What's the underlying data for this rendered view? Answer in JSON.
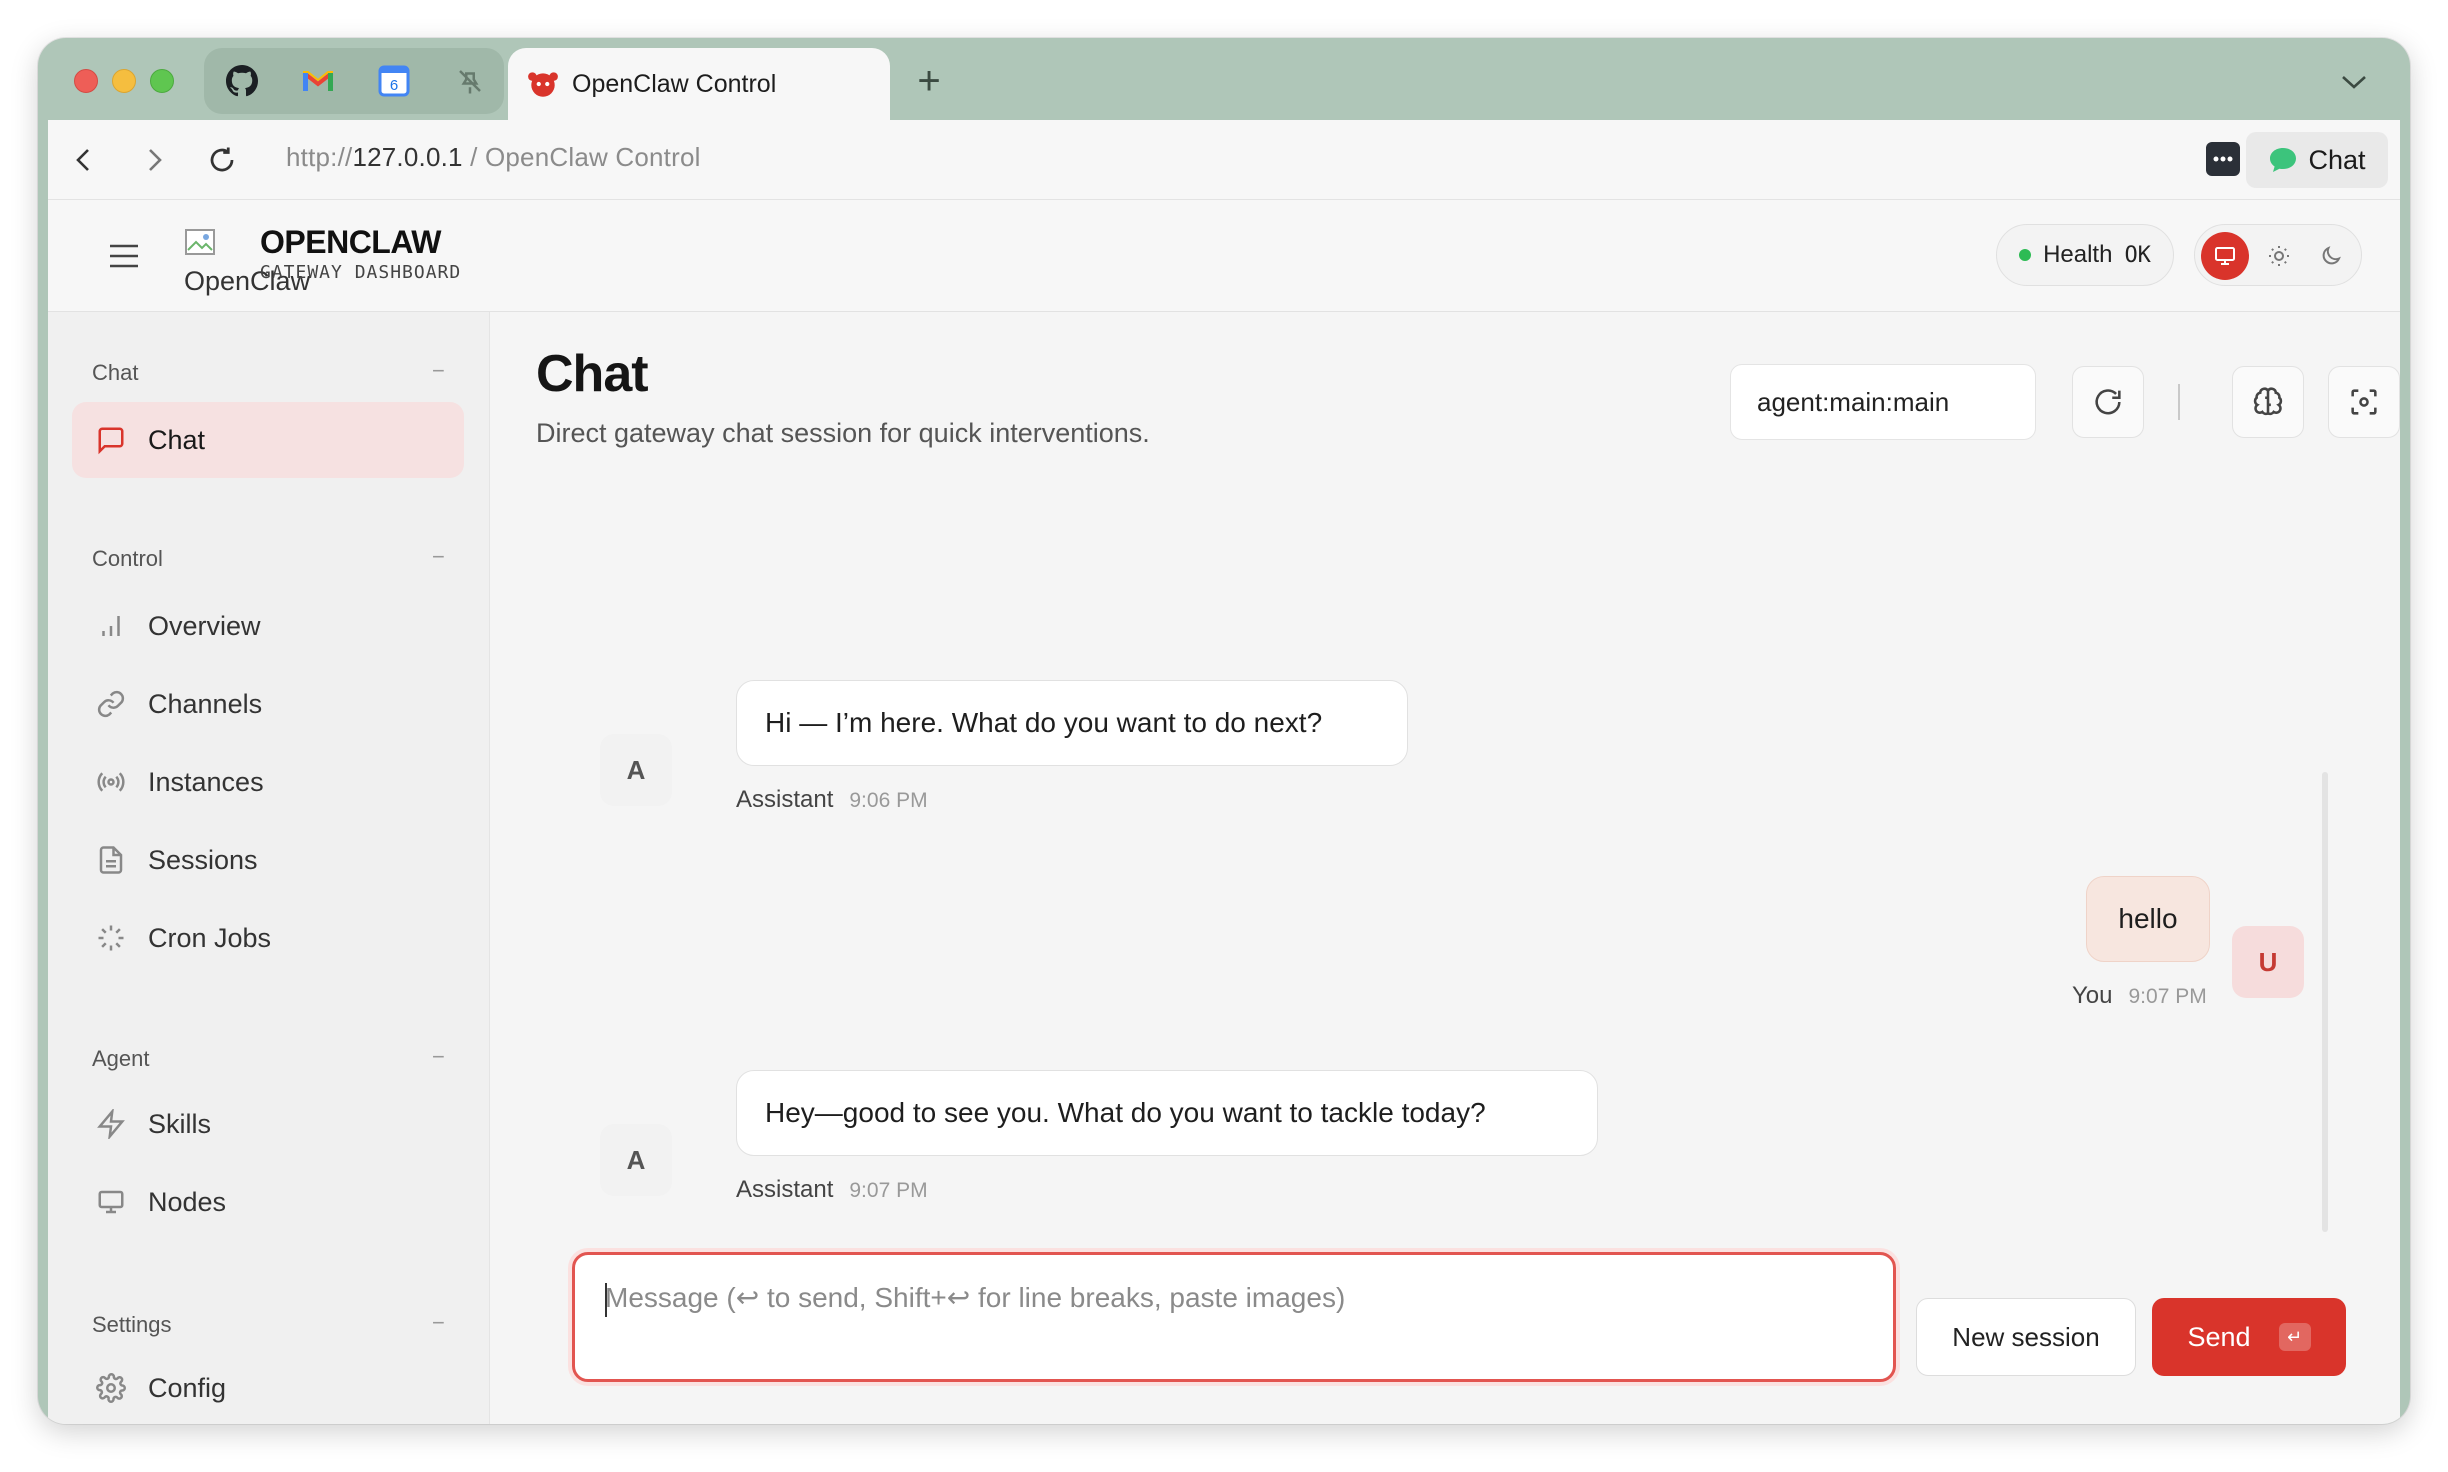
{
  "browser": {
    "active_tab_title": "OpenClaw Control",
    "new_tab_label": "+",
    "pinned_tabs": [
      "github-icon",
      "gmail-icon",
      "calendar-icon",
      "pin-icon"
    ],
    "calendar_badge": "6",
    "url_scheme": "http://",
    "url_host": "127.0.0.1",
    "url_rest": " / OpenClaw Control",
    "chat_extension_label": "Chat"
  },
  "header": {
    "logo_alt": "OpenClaw",
    "brand": "OPENCLAW",
    "brand_sub": "GATEWAY DASHBOARD",
    "health_label": "Health",
    "health_status": "OK",
    "health_color": "#2dbb54",
    "accent_color": "#d9342b"
  },
  "sidebar": {
    "sections": [
      {
        "title": "Chat",
        "collapse": "−",
        "items": [
          {
            "label": "Chat",
            "icon": "message-square-icon",
            "active": true
          }
        ]
      },
      {
        "title": "Control",
        "collapse": "−",
        "items": [
          {
            "label": "Overview",
            "icon": "bar-chart-icon"
          },
          {
            "label": "Channels",
            "icon": "link-icon"
          },
          {
            "label": "Instances",
            "icon": "radio-icon"
          },
          {
            "label": "Sessions",
            "icon": "file-text-icon"
          },
          {
            "label": "Cron Jobs",
            "icon": "loader-icon"
          }
        ]
      },
      {
        "title": "Agent",
        "collapse": "−",
        "items": [
          {
            "label": "Skills",
            "icon": "zap-icon"
          },
          {
            "label": "Nodes",
            "icon": "monitor-icon"
          }
        ]
      },
      {
        "title": "Settings",
        "collapse": "−",
        "items": [
          {
            "label": "Config",
            "icon": "gear-icon"
          }
        ]
      }
    ]
  },
  "main": {
    "title": "Chat",
    "subtitle": "Direct gateway chat session for quick interventions.",
    "session_key": "agent:main:main",
    "messages": [
      {
        "role": "assistant",
        "avatar": "A",
        "text": "Hi — I’m here. What do you want to do next?",
        "sender": "Assistant",
        "time": "9:06 PM"
      },
      {
        "role": "user",
        "avatar": "U",
        "text": "hello",
        "sender": "You",
        "time": "9:07 PM"
      },
      {
        "role": "assistant",
        "avatar": "A",
        "text": "Hey—good to see you. What do you want to tackle today?",
        "sender": "Assistant",
        "time": "9:07 PM"
      }
    ],
    "composer": {
      "value": "",
      "placeholder": "Message (↩ to send, Shift+↩ for line breaks, paste images)"
    },
    "new_session_label": "New session",
    "send_label": "Send",
    "send_kbd": "↵"
  }
}
